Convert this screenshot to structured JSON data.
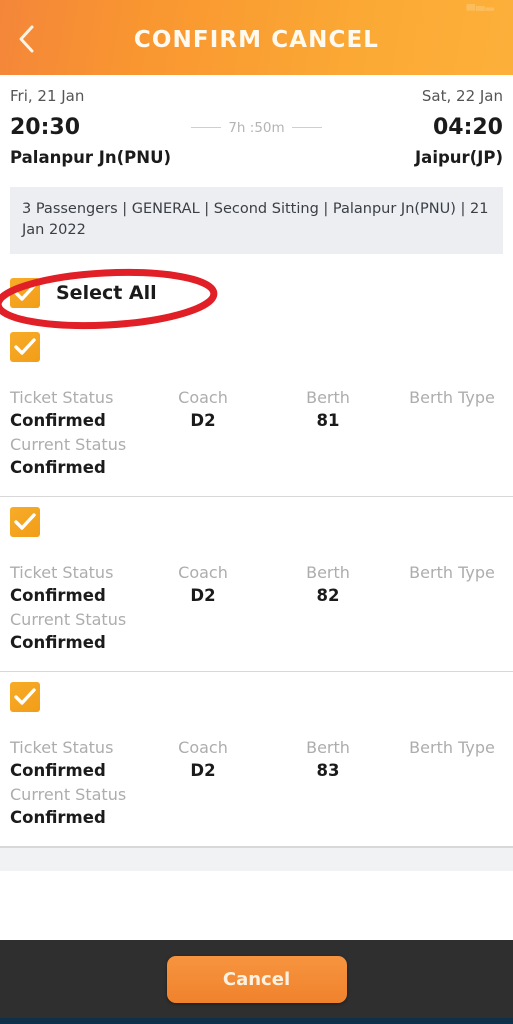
{
  "header": {
    "title": "CONFIRM CANCEL",
    "back_icon": "chevron-left-icon",
    "status_fragment": "▄▃▂",
    "gradient_from": "#f4863a",
    "gradient_to": "#fcb03a"
  },
  "journey": {
    "depart_date": "Fri, 21 Jan",
    "arrive_date": "Sat, 22 Jan",
    "depart_time": "20:30",
    "arrive_time": "04:20",
    "duration": "7h :50m",
    "from_station": "Palanpur Jn(PNU)",
    "to_station": "Jaipur(JP)"
  },
  "summary": {
    "text": "3 Passengers | GENERAL | Second Sitting | Palanpur Jn(PNU) | 21 Jan 2022"
  },
  "select_all": {
    "label": "Select All",
    "checked": true,
    "check_icon": "checkmark-icon",
    "annotation_color": "#e01f26"
  },
  "columns": {
    "ticket_status": "Ticket Status",
    "coach": "Coach",
    "berth": "Berth",
    "berth_type": "Berth Type",
    "current_status": "Current Status"
  },
  "passengers": [
    {
      "checked": true,
      "ticket_status": "Confirmed",
      "coach": "D2",
      "berth": "81",
      "berth_type": "",
      "current_status": "Confirmed"
    },
    {
      "checked": true,
      "ticket_status": "Confirmed",
      "coach": "D2",
      "berth": "82",
      "berth_type": "",
      "current_status": "Confirmed"
    },
    {
      "checked": true,
      "ticket_status": "Confirmed",
      "coach": "D2",
      "berth": "83",
      "berth_type": "",
      "current_status": "Confirmed"
    }
  ],
  "footer": {
    "cancel_label": "Cancel",
    "button_color": "#f4892f",
    "bar_color": "#2f2f2f"
  }
}
